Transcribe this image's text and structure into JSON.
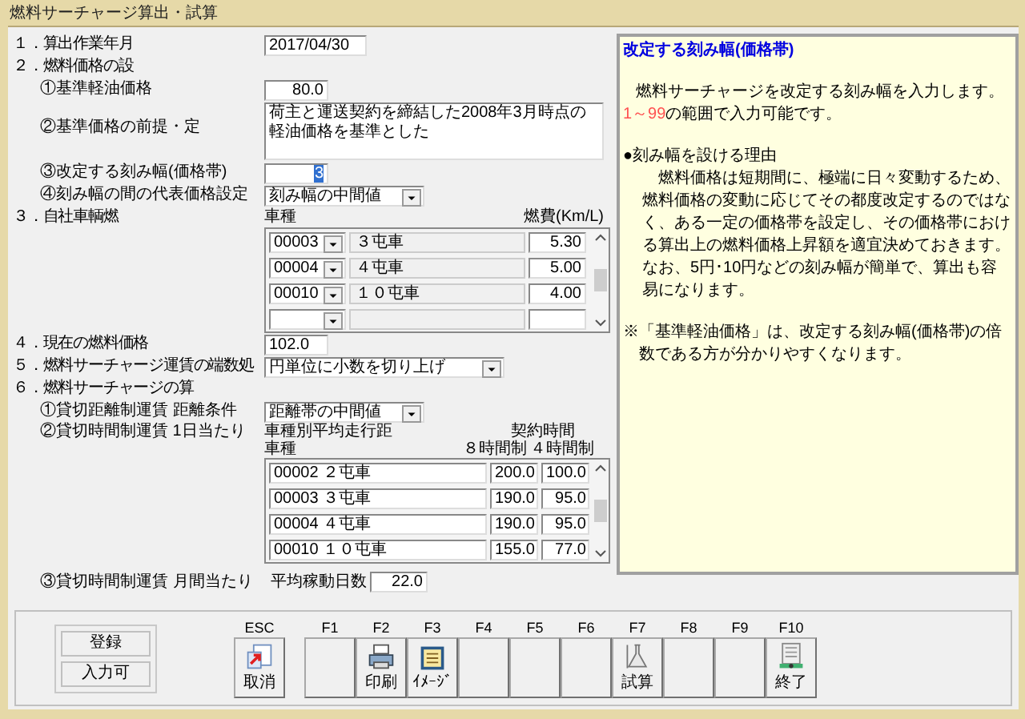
{
  "window": {
    "title": "燃料サーチャージ算出・試算"
  },
  "calc_month": {
    "label": "１．算出作業年月",
    "value": "2017/04/30"
  },
  "fuel_price": {
    "label": "２．燃料価格の設",
    "base_price": {
      "label": "①基準軽油価格",
      "value": "80.0"
    },
    "premise": {
      "label": "②基準価格の前提・定",
      "value": "荷主と運送契約を締結した2008年3月時点の軽油価格を基準とした"
    },
    "step": {
      "label": "③改定する刻み幅(価格帯)",
      "value": "3",
      "text_selected": true
    },
    "representative": {
      "label": "④刻み幅の間の代表価格設定",
      "value": "刻み幅の中間値"
    }
  },
  "own_vehicles": {
    "label": "３．自社車輌燃",
    "columns": [
      "車種",
      "燃費(Km/L)"
    ],
    "rows": [
      {
        "code": "00003",
        "name": "３屯車",
        "mileage": "5.30"
      },
      {
        "code": "00004",
        "name": "４屯車",
        "mileage": "5.00"
      },
      {
        "code": "00010",
        "name": "１０屯車",
        "mileage": "4.00"
      },
      {}
    ]
  },
  "current_price": {
    "label": "４．現在の燃料価格",
    "value": "102.0"
  },
  "rounding": {
    "label": "５．燃料サーチャージ運賃の端数処",
    "value": "円単位に小数を切り上げ"
  },
  "surcharge": {
    "label": "６．燃料サーチャージの算",
    "distance": {
      "label": "①貸切距離制運賃 距離条件",
      "value": "距離帯の中間値"
    },
    "time": {
      "label": "②貸切時間制運賃 1日当たり",
      "caption": "車種別平均走行距",
      "column_group": "契約時間",
      "columns": [
        "車種",
        "８時間制",
        "４時間制"
      ],
      "rows": [
        {
          "vehicle": "00002 ２屯車",
          "h8": "200.0",
          "h4": "100.0"
        },
        {
          "vehicle": "00003 ３屯車",
          "h8": "190.0",
          "h4": "95.0"
        },
        {
          "vehicle": "00004 ４屯車",
          "h8": "190.0",
          "h4": "95.0"
        },
        {
          "vehicle": "00010 １０屯車",
          "h8": "155.0",
          "h4": "77.0"
        }
      ]
    },
    "monthly": {
      "label": "③貸切時間制運賃 月間当たり",
      "days_label": "平均稼動日数",
      "value": "22.0"
    }
  },
  "help": {
    "title": "改定する刻み幅(価格帯)",
    "intro": "燃料サーチャージを改定する刻み幅を入力します。",
    "range": {
      "highlight": "1～99",
      "text": "の範囲で入力可能です。"
    },
    "reason": {
      "heading": "●刻み幅を設ける理由",
      "body": "燃料価格は短期間に、極端に日々変動するため、燃料価格の変動に応じてその都度改定するのではなく、ある一定の価格帯を設定し、その価格帯における算出上の燃料価格上昇額を適宜決めておきます。",
      "note": "なお、5円･10円などの刻み幅が簡単で、算出も容易になります。"
    },
    "remark": "※「基準軽油価格」は、改定する刻み幅(価格帯)の倍数である方が分かりやすくなります。"
  },
  "status": [
    "登録",
    "入力可"
  ],
  "function_keys": [
    {
      "key": "ESC",
      "label": "取消",
      "kind": "cancel"
    },
    {
      "key": "F1"
    },
    {
      "key": "F2",
      "label": "印刷",
      "kind": "print"
    },
    {
      "key": "F3",
      "label": "ｲﾒｰｼﾞ",
      "kind": "image"
    },
    {
      "key": "F4"
    },
    {
      "key": "F5"
    },
    {
      "key": "F6"
    },
    {
      "key": "F7",
      "label": "試算",
      "kind": "flask"
    },
    {
      "key": "F8"
    },
    {
      "key": "F9"
    },
    {
      "key": "F10",
      "label": "終了",
      "kind": "exit"
    }
  ]
}
